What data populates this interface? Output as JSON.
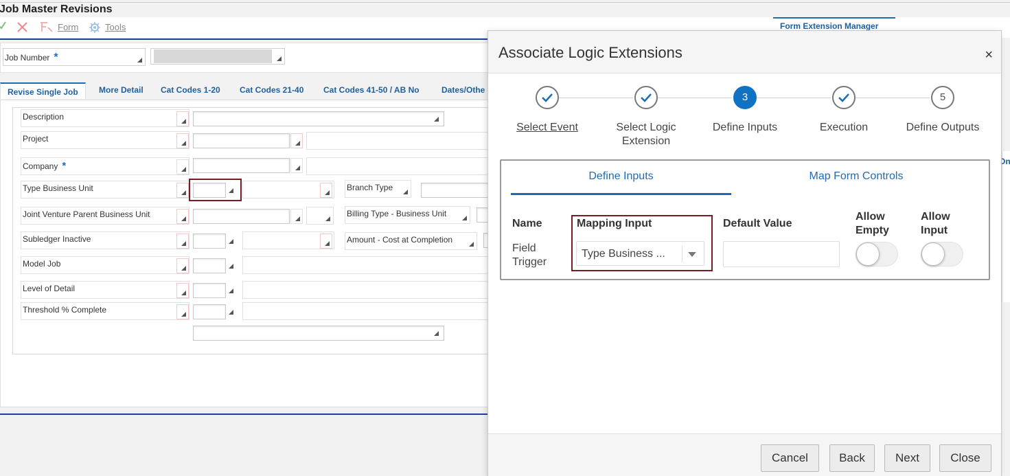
{
  "background_form": {
    "title": "Job Master Revisions",
    "toolbar": {
      "ok_icon": "check-icon",
      "cancel_icon": "close-icon",
      "form_label": "Form",
      "tools_label": "Tools"
    },
    "form_extension_tab": "Form Extension Manager",
    "job_number_label": "Job Number",
    "tabs": [
      "Revise Single Job",
      "More Detail",
      "Cat Codes 1-20",
      "Cat Codes 21-40",
      "Cat Codes 41-50 / AB No",
      "Dates/Othe"
    ],
    "fields": {
      "description": "Description",
      "project": "Project",
      "company": "Company",
      "type_business_unit": "Type Business Unit",
      "branch_type": "Branch Type",
      "joint_venture_parent": "Joint Venture Parent Business Unit",
      "billing_type": "Billing Type - Business Unit",
      "subledger_inactive": "Subledger Inactive",
      "amount_cost_at_completion": "Amount - Cost at Completion",
      "model_job": "Model Job",
      "level_of_detail": "Level of Detail",
      "threshold_complete": "Threshold % Complete"
    },
    "required_marker": "*",
    "right_edge_text": "On"
  },
  "modal": {
    "title": "Associate Logic Extensions",
    "close_label": "×",
    "steps": [
      {
        "label": "Select Event",
        "state": "done"
      },
      {
        "label": "Select Logic Extension",
        "state": "done"
      },
      {
        "label": "Define Inputs",
        "state": "active",
        "number": "3"
      },
      {
        "label": "Execution",
        "state": "done"
      },
      {
        "label": "Define Outputs",
        "state": "pending",
        "number": "5"
      }
    ],
    "inner_tabs": {
      "define_inputs": "Define Inputs",
      "map_form_controls": "Map Form Controls"
    },
    "columns": {
      "name": "Name",
      "mapping_input": "Mapping Input",
      "default_value": "Default Value",
      "allow_empty": "Allow Empty",
      "allow_input": "Allow Input"
    },
    "row": {
      "name": "Field Trigger",
      "mapping_input_value": "Type Business ...",
      "default_value": "",
      "allow_empty": false,
      "allow_input": false
    },
    "buttons": {
      "cancel": "Cancel",
      "back": "Back",
      "next": "Next",
      "close": "Close"
    },
    "colors": {
      "accent": "#0f72c2",
      "highlight": "#7a1a24"
    }
  }
}
